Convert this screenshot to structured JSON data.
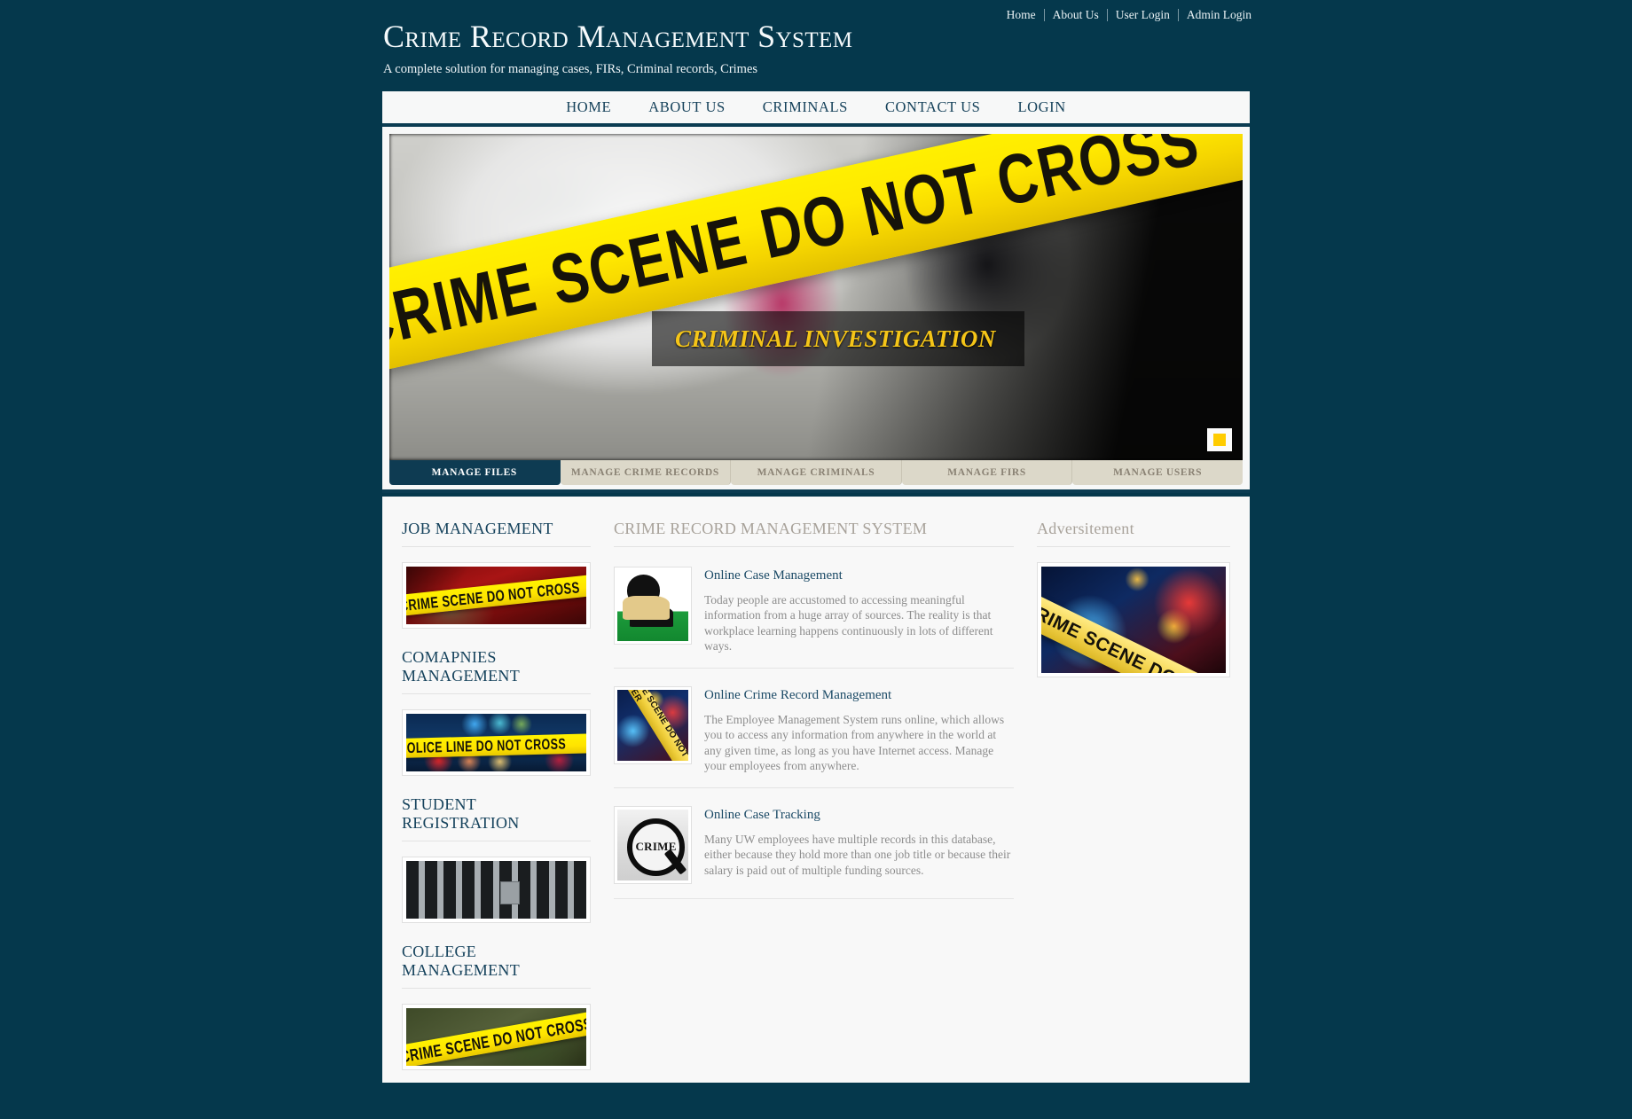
{
  "colors": {
    "page_background": "#05384c",
    "panel_background": "#f8f8f8",
    "accent_dark": "#0e3b52",
    "tab_inactive": "#dcd8c9",
    "link_blue": "#16425b",
    "caption_yellow": "#f5c518",
    "slider_dot": "#ffcc00"
  },
  "top_nav": {
    "items": [
      {
        "label": "Home"
      },
      {
        "label": "About Us"
      },
      {
        "label": "User Login"
      },
      {
        "label": "Admin Login"
      }
    ]
  },
  "brand": {
    "title": "Crime Record Management System",
    "tagline": "A complete solution for managing cases, FIRs, Criminal records, Crimes"
  },
  "main_nav": {
    "items": [
      {
        "label": "HOME"
      },
      {
        "label": "ABOUT US"
      },
      {
        "label": "CRIMINALS"
      },
      {
        "label": "CONTACT US"
      },
      {
        "label": "LOGIN"
      }
    ]
  },
  "hero": {
    "tape_text": "CRIME SCENE DO NOT CROSS",
    "caption": "CRIMINAL INVESTIGATION",
    "slider_indicator": "slide-1"
  },
  "tabs": [
    {
      "label": "MANAGE FILES",
      "active": true
    },
    {
      "label": "MANAGE CRIME RECORDS",
      "active": false
    },
    {
      "label": "MANAGE CRIMINALS",
      "active": false
    },
    {
      "label": "MANAGE FIRS",
      "active": false
    },
    {
      "label": "MANAGE USERS",
      "active": false
    }
  ],
  "sidebar": {
    "sections": [
      {
        "title": "JOB MANAGEMENT",
        "image_alt": "CRIME SCENE DO NOT CROSS",
        "tape_text": "CRIME SCENE DO NOT CROSS"
      },
      {
        "title": "COMAPNIES MANAGEMENT",
        "image_alt": "POLICE LINE DO NOT CROSS",
        "tape_text": "POLICE LINE DO NOT CROSS"
      },
      {
        "title": "STUDENT REGISTRATION",
        "image_alt": "Jail cell bars",
        "tape_text": ""
      },
      {
        "title": "COLLEGE MANAGEMENT",
        "image_alt": "CRIME SCENE DO NOT CROSS",
        "tape_text": "CRIME SCENE DO NOT CROSS"
      }
    ]
  },
  "main": {
    "heading": "CRIME RECORD MANAGEMENT SYSTEM",
    "articles": [
      {
        "title": "Online Case Management",
        "body": "Today people are accustomed to accessing meaningful information from a huge array of sources. The reality is that workplace learning happens continuously in lots of different ways.",
        "image_alt": "Police officer on telephone"
      },
      {
        "title": "Online Crime Record Management",
        "body": "The Employee Management System runs online, which allows you to access any information from anywhere in the world at any given time, as long as you have Internet access. Manage your employees from anywhere.",
        "image_alt": "CRIME SCENE DO NOT ENTER tape"
      },
      {
        "title": "Online Case Tracking",
        "body": "Many UW employees have multiple records in this database, either because they hold more than one job title or because their salary is paid out of multiple funding sources.",
        "image_alt": "Magnifying glass over the word CRIME"
      }
    ]
  },
  "advertisement": {
    "heading": "Adversitement",
    "image_alt": "CRIME SCENE DO NOT ENTER",
    "tape_text": "CRIME SCENE DO NOT ENTER"
  }
}
